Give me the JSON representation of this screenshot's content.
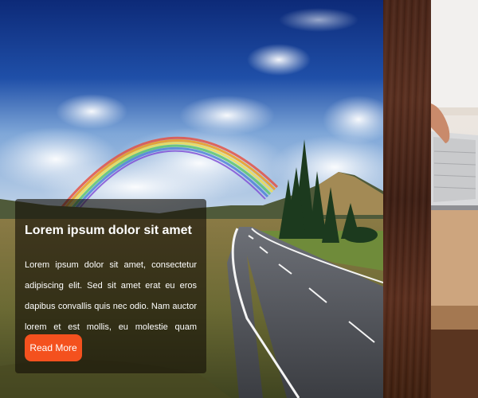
{
  "slider": {
    "active_slide": {
      "caption": {
        "title": "Lorem ipsum dolor sit amet",
        "body": "Lorem ipsum dolor sit amet, consectetur adipiscing elit. Sed sit amet erat eu eros dapibus convallis quis nec odio. Nam auctor lorem et est mollis, eu molestie quam interdum.",
        "button_label": "Read More"
      }
    }
  },
  "colors": {
    "button": "#f4511e",
    "caption_overlay": "rgba(20,14,6,0.62)",
    "caption_text": "#ffffff"
  }
}
